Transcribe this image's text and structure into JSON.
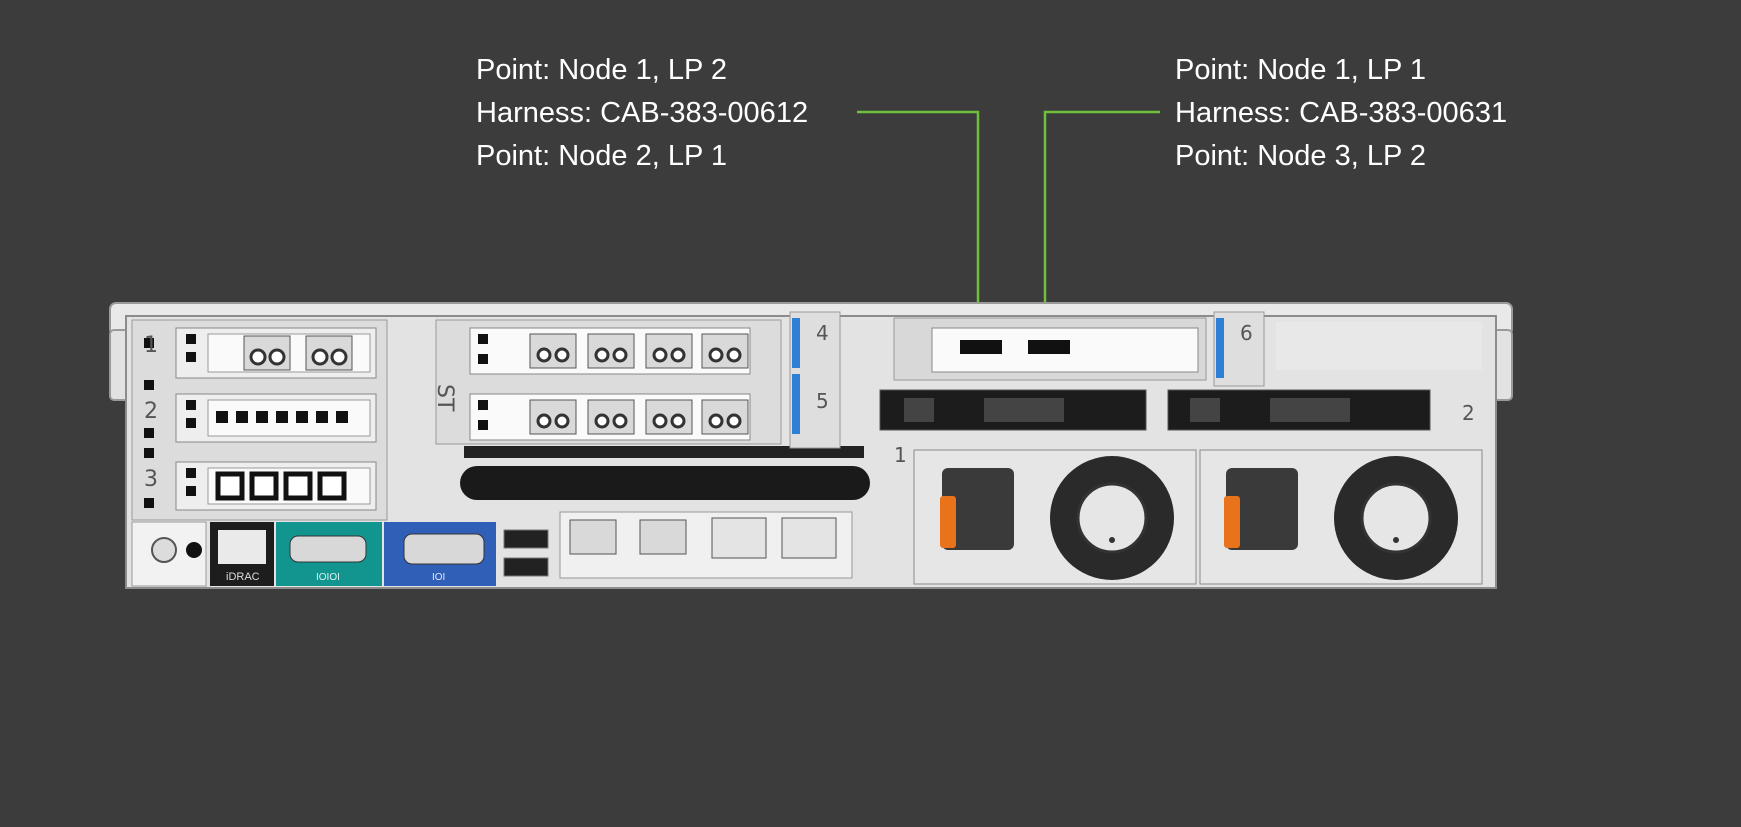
{
  "callouts": {
    "left": {
      "line1": "Point: Node 1, LP 2",
      "line2": "Harness: CAB-383-00612",
      "line3": "Point: Node 2, LP 1"
    },
    "right": {
      "line1": "Point: Node 1, LP 1",
      "line2": "Harness: CAB-383-00631",
      "line3": "Point: Node 3, LP 2"
    }
  },
  "server": {
    "slot_labels": [
      "1",
      "2",
      "3",
      "4",
      "5",
      "6"
    ],
    "psu_labels": [
      "1",
      "2"
    ],
    "port_labels": {
      "idrac": "iDRAC",
      "serial": "IOIOI",
      "vga": "IOI"
    },
    "st_label": "ST"
  },
  "colors": {
    "background": "#3c3c3c",
    "leader_line": "#6fbf3a",
    "chassis": "#e3e3e3",
    "serial_port_bg": "#12958f",
    "vga_port_bg": "#2f5fb7",
    "slot_tab": "#2e7fd6",
    "psu_handle": "#e8731a"
  }
}
